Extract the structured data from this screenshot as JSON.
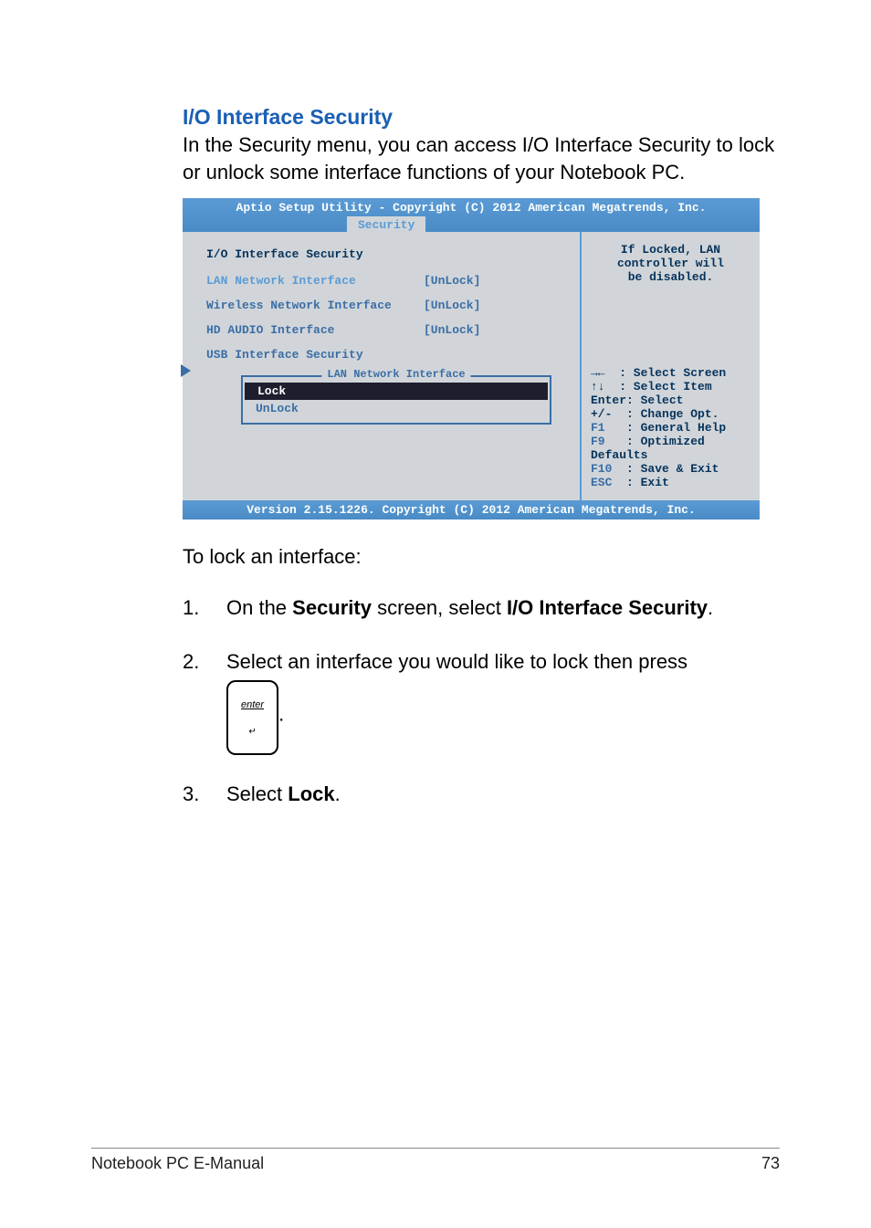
{
  "heading": "I/O Interface Security",
  "intro": "In the Security menu, you can access I/O Interface Security to lock or unlock some interface functions of your Notebook PC.",
  "bios": {
    "header": "Aptio Setup Utility - Copyright (C) 2012 American Megatrends, Inc.",
    "tab": "Security",
    "panel_title": "I/O Interface Security",
    "rows": [
      {
        "label": "LAN Network Interface",
        "value": "[UnLock]"
      },
      {
        "label": "Wireless Network Interface",
        "value": "[UnLock]"
      },
      {
        "label": "HD AUDIO Interface",
        "value": "[UnLock]"
      }
    ],
    "submenu": "USB Interface Security",
    "popup": {
      "title": "LAN Network Interface",
      "selected": "Lock",
      "other": "UnLock"
    },
    "help": {
      "l1": "If Locked, LAN",
      "l2": "controller will",
      "l3": "be disabled.",
      "k1": "→←  : Select Screen",
      "k2": "↑↓  : Select Item",
      "k3": "Enter: Select",
      "k4": "+/-  : Change Opt.",
      "k5a": "F1",
      "k5b": "   : General Help",
      "k6a": "F9",
      "k6b": "   : Optimized",
      "k7": "Defaults",
      "k8a": "F10",
      "k8b": "  : Save & Exit",
      "k9a": "ESC",
      "k9b": "  : Exit"
    },
    "footer": "Version 2.15.1226. Copyright (C) 2012 American Megatrends, Inc."
  },
  "steps_intro": "To lock an interface:",
  "steps": {
    "s1num": "1.",
    "s1a": "On the ",
    "s1b": "Security",
    "s1c": " screen, select ",
    "s1d": "I/O Interface Security",
    "s1e": ".",
    "s2num": "2.",
    "s2a": "Select an interface you would like to lock then press ",
    "s2key": "enter",
    "s2end": ".",
    "s3num": "3.",
    "s3a": "Select ",
    "s3b": "Lock",
    "s3c": "."
  },
  "footer": {
    "left": "Notebook PC E-Manual",
    "right": "73"
  }
}
